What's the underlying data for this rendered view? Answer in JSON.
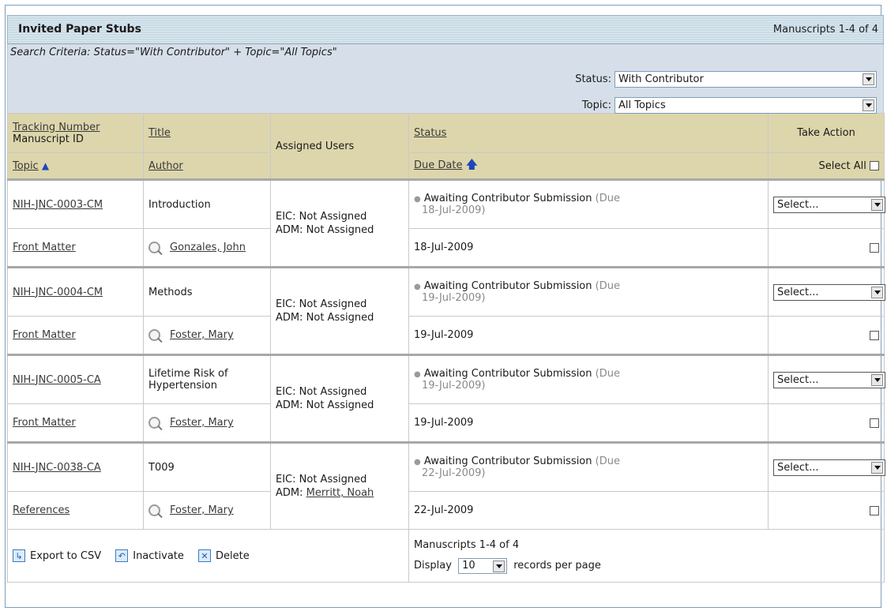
{
  "panel": {
    "title": "Invited Paper Stubs",
    "count_label": "Manuscripts 1-4 of 4"
  },
  "search_criteria": "Search Criteria: Status=\"With Contributor\" + Topic=\"All Topics\"",
  "filters": {
    "status_label": "Status:",
    "status_value": "With Contributor",
    "topic_label": "Topic:",
    "topic_value": "All Topics"
  },
  "columns": {
    "tracking_number": "Tracking Number",
    "manuscript_id": "Manuscript ID",
    "title": "Title",
    "assigned_users": "Assigned Users",
    "status": "Status",
    "take_action": "Take Action",
    "topic": "Topic",
    "author": "Author",
    "due_date": "Due Date",
    "select_all": "Select All"
  },
  "rows": [
    {
      "id": "NIH-JNC-0003-CM",
      "title": "Introduction",
      "eic": "EIC: Not Assigned",
      "adm_prefix": "ADM:",
      "adm_value": "Not Assigned",
      "adm_link": false,
      "status": "Awaiting Contributor Submission",
      "due_prefix": "(Due",
      "due_suffix": "18-Jul-2009)",
      "topic": "Front Matter",
      "author": "Gonzales, John",
      "due_date": "18-Jul-2009",
      "action": "Select..."
    },
    {
      "id": "NIH-JNC-0004-CM",
      "title": "Methods",
      "eic": "EIC: Not Assigned",
      "adm_prefix": "ADM:",
      "adm_value": "Not Assigned",
      "adm_link": false,
      "status": "Awaiting Contributor Submission",
      "due_prefix": "(Due",
      "due_suffix": "19-Jul-2009)",
      "topic": "Front Matter",
      "author": "Foster, Mary",
      "due_date": "19-Jul-2009",
      "action": "Select..."
    },
    {
      "id": "NIH-JNC-0005-CA",
      "title": "Lifetime Risk of Hypertension",
      "eic": "EIC: Not Assigned",
      "adm_prefix": "ADM:",
      "adm_value": "Not Assigned",
      "adm_link": false,
      "status": "Awaiting Contributor Submission",
      "due_prefix": "(Due",
      "due_suffix": "19-Jul-2009)",
      "topic": "Front Matter",
      "author": "Foster, Mary",
      "due_date": "19-Jul-2009",
      "action": "Select..."
    },
    {
      "id": "NIH-JNC-0038-CA",
      "title": "T009",
      "eic": "EIC: Not Assigned",
      "adm_prefix": "ADM:",
      "adm_value": "Merritt, Noah",
      "adm_link": true,
      "status": "Awaiting Contributor Submission",
      "due_prefix": "(Due",
      "due_suffix": "22-Jul-2009)",
      "topic": "References",
      "author": "Foster, Mary",
      "due_date": "22-Jul-2009",
      "action": "Select..."
    }
  ],
  "footer": {
    "export_label": "Export to CSV",
    "inactivate_label": "Inactivate",
    "delete_label": "Delete",
    "count_label": "Manuscripts 1-4 of 4",
    "display_label": "Display",
    "display_value": "10",
    "per_page_label": "records per page"
  },
  "icons": {
    "sort_up": "up-arrow-icon",
    "author_lookup": "magnifier-icon",
    "dropdown": "chevron-down-icon"
  },
  "colors": {
    "header_bg": "#ddd6ac",
    "criteria_bg": "#d6dfe9",
    "title_bg": "#c9dbe6",
    "sort_arrow": "#1f47b8"
  }
}
